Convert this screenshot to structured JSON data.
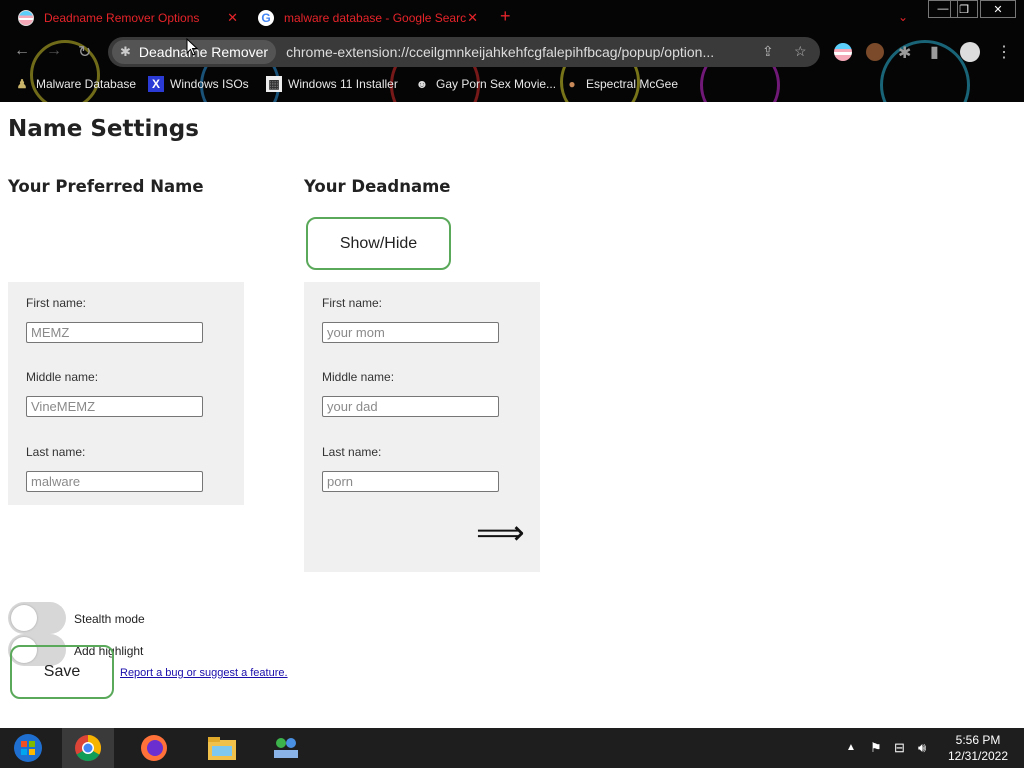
{
  "browser": {
    "tabs": [
      {
        "title": "Deadname Remover Options",
        "active": true
      },
      {
        "title": "malware database - Google Searc",
        "active": false
      }
    ],
    "new_tab_icon": "plus-icon",
    "address": {
      "site_chip": "Deadname Remover",
      "url": "chrome-extension://cceilgmnkeijahkehfcgfalepihfbcag/popup/option..."
    },
    "bookmarks": [
      {
        "label": "Malware Database"
      },
      {
        "label": "Windows ISOs"
      },
      {
        "label": "Windows 11 Installer"
      },
      {
        "label": "Gay Porn Sex Movie..."
      },
      {
        "label": "Espectral McGee"
      }
    ],
    "colors": {
      "tab_text": "#e5242a",
      "chrome_bg": "#050505"
    }
  },
  "page": {
    "title": "Name Settings",
    "preferred": {
      "heading": "Your Preferred Name",
      "first_label": "First name:",
      "first_placeholder": "MEMZ",
      "middle_label": "Middle name:",
      "middle_placeholder": "VineMEMZ",
      "last_label": "Last name:",
      "last_placeholder": "malware"
    },
    "deadname": {
      "heading": "Your Deadname",
      "show_hide": "Show/Hide",
      "first_label": "First name:",
      "first_placeholder": "your mom",
      "middle_label": "Middle name:",
      "middle_placeholder": "your dad",
      "last_label": "Last name:",
      "last_placeholder": "porn",
      "arrow": "⟹"
    },
    "stealth_label": "Stealth mode",
    "highlight_label": "Add highlight",
    "save": "Save",
    "report_link": "Report a bug or suggest a feature.",
    "accent_color": "#5aa85a"
  },
  "taskbar": {
    "time": "5:56 PM",
    "date": "12/31/2022"
  }
}
